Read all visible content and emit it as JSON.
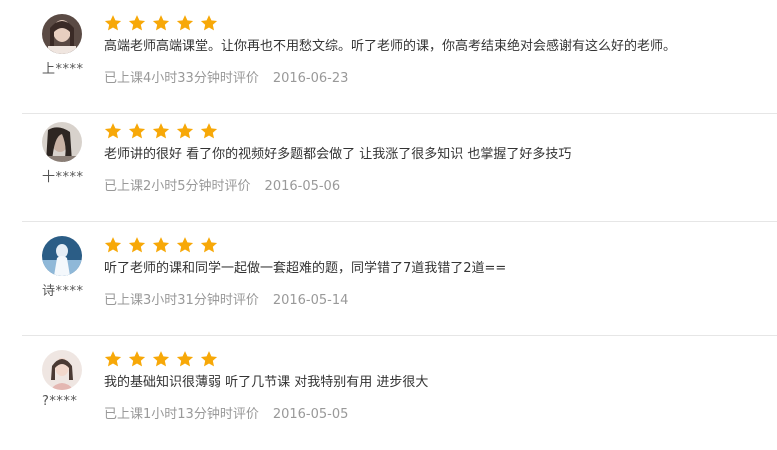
{
  "colors": {
    "star": "#f7a808",
    "divider": "#e6e6e6",
    "meta_text": "#999999"
  },
  "reviews": [
    {
      "username": "上****",
      "rating": 5,
      "content": "高端老师高端课堂。让你再也不用愁文综。听了老师的课，你高考结束绝对会感谢有这么好的老师。",
      "study_time": "已上课4小时33分钟时评价",
      "date": "2016-06-23",
      "avatar_icon": "user-avatar-photo"
    },
    {
      "username": "十****",
      "rating": 5,
      "content": "老师讲的很好 看了你的视频好多题都会做了 让我涨了很多知识 也掌握了好多技巧",
      "study_time": "已上课2小时5分钟时评价",
      "date": "2016-05-06",
      "avatar_icon": "user-avatar-photo"
    },
    {
      "username": "诗****",
      "rating": 5,
      "content": "听了老师的课和同学一起做一套超难的题，同学错了7道我错了2道==",
      "study_time": "已上课3小时31分钟时评价",
      "date": "2016-05-14",
      "avatar_icon": "user-avatar-photo"
    },
    {
      "username": "?****",
      "rating": 5,
      "content": "我的基础知识很薄弱 听了几节课 对我特别有用 进步很大",
      "study_time": "已上课1小时13分钟时评价",
      "date": "2016-05-05",
      "avatar_icon": "user-avatar-photo"
    }
  ]
}
